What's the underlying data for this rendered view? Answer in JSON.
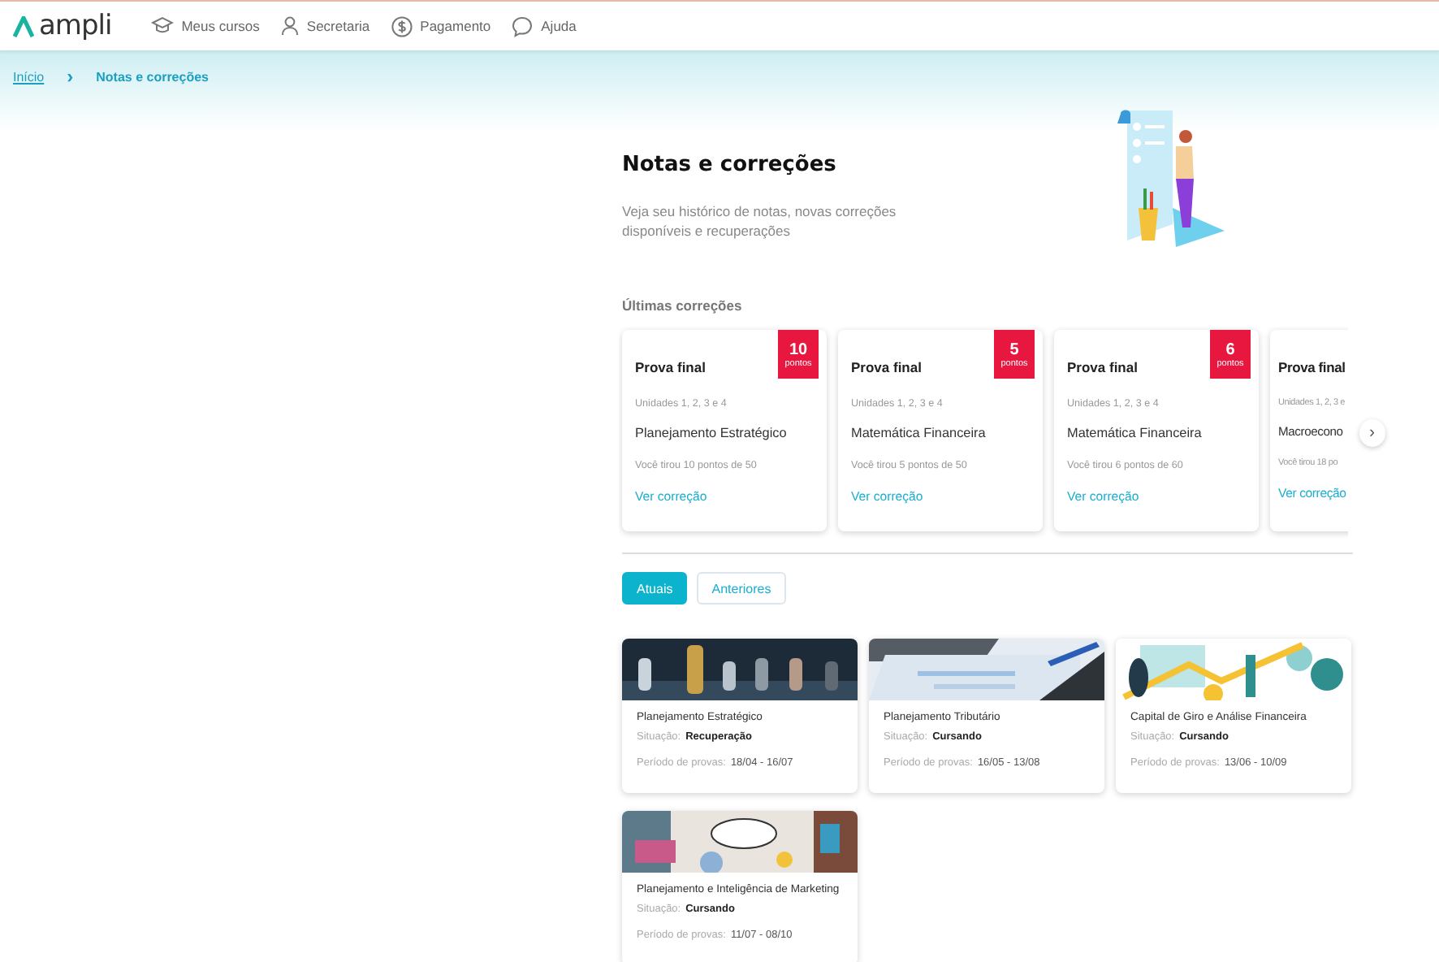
{
  "nav": {
    "logo": "ampli",
    "items": [
      {
        "label": "Meus cursos"
      },
      {
        "label": "Secretaria"
      },
      {
        "label": "Pagamento"
      },
      {
        "label": "Ajuda"
      }
    ]
  },
  "breadcrumb": [
    {
      "label": "Início",
      "kind": "link"
    },
    {
      "label": "›",
      "kind": "separator"
    },
    {
      "label": "Notas e correções",
      "kind": "current"
    }
  ],
  "header": {
    "title": "Notas e correções",
    "subtitle": "Veja seu histórico de notas, novas correções disponíveis e recuperações"
  },
  "recent": {
    "title": "Últimas correções",
    "next": "›",
    "cards": [
      {
        "title": "Prova final",
        "units": "Unidades 1, 2, 3 e 4",
        "course": "Planejamento Estratégico",
        "score_text": "Você tirou 10 pontos de 50",
        "link": "Ver correção",
        "points": "10",
        "points_label": "pontos"
      },
      {
        "title": "Prova final",
        "units": "Unidades 1, 2, 3 e 4",
        "course": "Matemática Financeira",
        "score_text": "Você tirou 5 pontos de 50",
        "link": "Ver correção",
        "points": "5",
        "points_label": "pontos"
      },
      {
        "title": "Prova final",
        "units": "Unidades 1, 2, 3 e 4",
        "course": "Matemática Financeira",
        "score_text": "Você tirou 6 pontos de 60",
        "link": "Ver correção",
        "points": "6",
        "points_label": "pontos"
      },
      {
        "title": "Prova final",
        "units": "Unidades 1, 2, 3 e",
        "course": "Macroecono",
        "score_text": "Você tirou 18 po",
        "link": "Ver correção"
      }
    ]
  },
  "tabs": [
    {
      "label": "Atuais",
      "selected": true
    },
    {
      "label": "Anteriores",
      "selected": false
    }
  ],
  "courses": [
    {
      "kind": "picture",
      "name": "Planejamento Estratégico",
      "situation_label": "Situação:",
      "situation": "Recuperação",
      "period_label": "Período de provas:",
      "period": "18/04 - 16/07"
    },
    {
      "kind": "picture",
      "name": "Planejamento Tributário",
      "situation_label": "Situação:",
      "situation": "Cursando",
      "period_label": "Período de provas:",
      "period": "16/05 - 13/08"
    },
    {
      "kind": "picture",
      "name": "Capital de Giro e Análise Financeira",
      "situation_label": "Situação:",
      "situation": "Cursando",
      "period_label": "Período de provas:",
      "period": "13/06 - 10/09"
    },
    {
      "kind": "picture",
      "name": "Planejamento e Inteligência de Marketing",
      "situation_label": "Situação:",
      "situation": "Cursando",
      "period_label": "Período de provas:",
      "period": "11/07 - 08/10"
    }
  ]
}
